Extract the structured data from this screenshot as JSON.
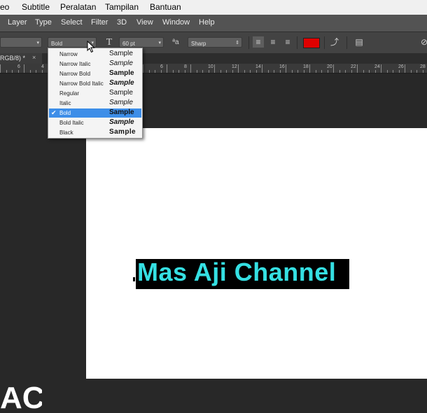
{
  "os_menu": [
    "eo",
    "Subtitle",
    "Peralatan",
    "Tampilan",
    "Bantuan"
  ],
  "ps_menu": [
    "Layer",
    "Type",
    "Select",
    "Filter",
    "3D",
    "View",
    "Window",
    "Help"
  ],
  "options": {
    "font_family_placeholder": "",
    "font_style": "Bold",
    "font_size": "60 pt",
    "antialias_icon_text": "ªa",
    "antialias": "Sharp",
    "text_color": "#e00000"
  },
  "tab": {
    "title": "RGB/8) *",
    "close": "×"
  },
  "ruler": [
    "6",
    "4",
    "2",
    "0",
    "2",
    "4",
    "6",
    "8",
    "10",
    "12",
    "14",
    "16",
    "18",
    "20",
    "22",
    "24",
    "26",
    "28"
  ],
  "font_styles": [
    {
      "label": "Narrow",
      "sample": "Sample"
    },
    {
      "label": "Narrow Italic",
      "sample": "Sample"
    },
    {
      "label": "Narrow Bold",
      "sample": "Sample"
    },
    {
      "label": "Narrow Bold Italic",
      "sample": "Sample"
    },
    {
      "label": "Regular",
      "sample": "Sample"
    },
    {
      "label": "Italic",
      "sample": "Sample"
    },
    {
      "label": "Bold",
      "sample": "Sample"
    },
    {
      "label": "Bold Italic",
      "sample": "Sample"
    },
    {
      "label": "Black",
      "sample": "Sample"
    }
  ],
  "selected_check": "✔",
  "canvas_text": "Mas Aji Channel",
  "logo_fragment": "AC",
  "colors": {
    "text_fill": "#35e0e3",
    "selection": "#3d8ee8",
    "text_color_swatch": "#e00000"
  }
}
